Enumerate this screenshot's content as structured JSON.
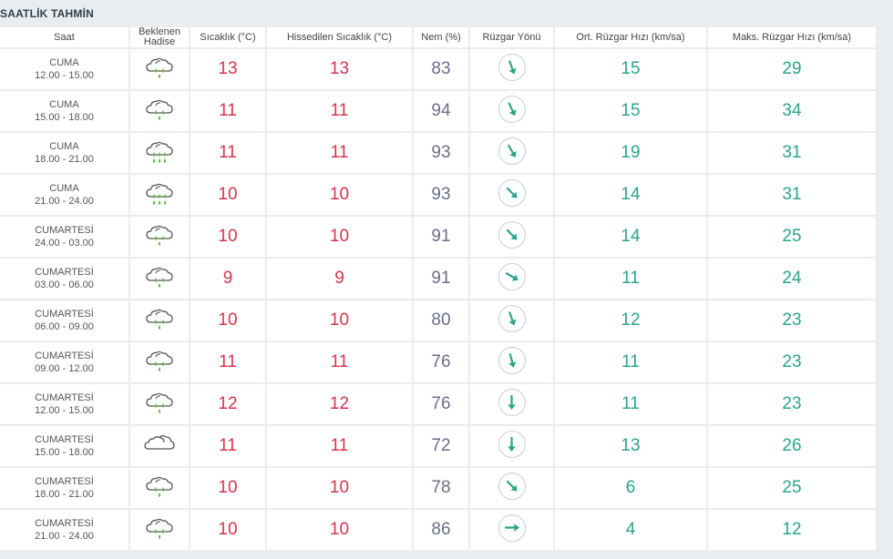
{
  "title": "SAATLİK TAHMİN",
  "columns": {
    "time": "Saat",
    "event": "Beklenen Hadise",
    "temp": "Sıcaklık (°C)",
    "feels": "Hissedilen Sıcaklık (°C)",
    "humidity": "Nem (%)",
    "wind_dir": "Rüzgar Yönü",
    "wind_avg": "Ort. Rüzgar Hızı (km/sa)",
    "wind_max": "Maks. Rüzgar Hızı (km/sa)"
  },
  "rows": [
    {
      "day": "CUMA",
      "range": "12.00 - 15.00",
      "icon": "light-rain-icon",
      "temp": "13",
      "feels": "13",
      "humidity": "83",
      "wind_dir_deg": 340,
      "wind_avg": "15",
      "wind_max": "29"
    },
    {
      "day": "CUMA",
      "range": "15.00 - 18.00",
      "icon": "light-rain-icon",
      "temp": "11",
      "feels": "11",
      "humidity": "94",
      "wind_dir_deg": 335,
      "wind_avg": "15",
      "wind_max": "34"
    },
    {
      "day": "CUMA",
      "range": "18.00 - 21.00",
      "icon": "rain-icon",
      "temp": "11",
      "feels": "11",
      "humidity": "93",
      "wind_dir_deg": 330,
      "wind_avg": "19",
      "wind_max": "31"
    },
    {
      "day": "CUMA",
      "range": "21.00 - 24.00",
      "icon": "rain-icon",
      "temp": "10",
      "feels": "10",
      "humidity": "93",
      "wind_dir_deg": 315,
      "wind_avg": "14",
      "wind_max": "31"
    },
    {
      "day": "CUMARTESİ",
      "range": "24.00 - 03.00",
      "icon": "light-rain-icon",
      "temp": "10",
      "feels": "10",
      "humidity": "91",
      "wind_dir_deg": 315,
      "wind_avg": "14",
      "wind_max": "25"
    },
    {
      "day": "CUMARTESİ",
      "range": "03.00 - 06.00",
      "icon": "light-rain-icon",
      "temp": "9",
      "feels": "9",
      "humidity": "91",
      "wind_dir_deg": 300,
      "wind_avg": "11",
      "wind_max": "24"
    },
    {
      "day": "CUMARTESİ",
      "range": "06.00 - 09.00",
      "icon": "light-rain-icon",
      "temp": "10",
      "feels": "10",
      "humidity": "80",
      "wind_dir_deg": 340,
      "wind_avg": "12",
      "wind_max": "23"
    },
    {
      "day": "CUMARTESİ",
      "range": "09.00 - 12.00",
      "icon": "light-rain-icon",
      "temp": "11",
      "feels": "11",
      "humidity": "76",
      "wind_dir_deg": 345,
      "wind_avg": "11",
      "wind_max": "23"
    },
    {
      "day": "CUMARTESİ",
      "range": "12.00 - 15.00",
      "icon": "light-rain-icon",
      "temp": "12",
      "feels": "12",
      "humidity": "76",
      "wind_dir_deg": 0,
      "wind_avg": "11",
      "wind_max": "23"
    },
    {
      "day": "CUMARTESİ",
      "range": "15.00 - 18.00",
      "icon": "cloudy-icon",
      "temp": "11",
      "feels": "11",
      "humidity": "72",
      "wind_dir_deg": 0,
      "wind_avg": "13",
      "wind_max": "26"
    },
    {
      "day": "CUMARTESİ",
      "range": "18.00 - 21.00",
      "icon": "light-rain-icon",
      "temp": "10",
      "feels": "10",
      "humidity": "78",
      "wind_dir_deg": 315,
      "wind_avg": "6",
      "wind_max": "25"
    },
    {
      "day": "CUMARTESİ",
      "range": "21.00 - 24.00",
      "icon": "light-rain-icon",
      "temp": "10",
      "feels": "10",
      "humidity": "86",
      "wind_dir_deg": 270,
      "wind_avg": "4",
      "wind_max": "12"
    }
  ],
  "colors": {
    "temp": "#d8344a",
    "humidity": "#6b6e8a",
    "wind": "#2aa58a",
    "rain": "#5dbb3e"
  }
}
